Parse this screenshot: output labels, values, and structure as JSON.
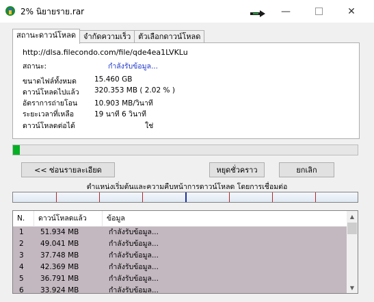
{
  "window": {
    "title": "2% นิยายราย.rar",
    "icon": "idm-app-icon",
    "controls": [
      "minimize-icon",
      "maximize-icon",
      "close-icon"
    ]
  },
  "tabs": [
    {
      "label": "สถานะดาวน์โหลด",
      "active": true
    },
    {
      "label": "จำกัดความเร็ว",
      "active": false
    },
    {
      "label": "ตัวเลือกดาวน์โหลด",
      "active": false
    }
  ],
  "info": {
    "url": "http://dlsa.filecondo.com/file/qde4ea1LVKLu",
    "status_label": "สถานะ:",
    "status_value": "กำลังรับข้อมูล...",
    "rows": [
      {
        "label": "ขนาดไฟล์ทั้งหมด",
        "value": "15.460  GB"
      },
      {
        "label": "ดาวน์โหลดไปแล้ว",
        "value": "320.353  MB  ( 2.02 % )"
      },
      {
        "label": "อัตราการถ่ายโอน",
        "value": "10.903  MB/วินาที"
      },
      {
        "label": "ระยะเวลาที่เหลือ",
        "value": "19  นาที 6  วินาที"
      },
      {
        "label": "ดาวน์โหลดต่อได้",
        "value": "ใช่"
      }
    ]
  },
  "progress": {
    "fraction": 0.0202,
    "color": "#06b025"
  },
  "buttons": {
    "hide_details": "<< ซ่อนรายละเอียด",
    "pause": "หยุดชั่วคราว",
    "cancel": "ยกเลิก"
  },
  "segments": {
    "caption": "ตำแหน่งเริ่มต้นและความคืบหน้าการดาวน์โหลด โดยการเชื่อมต่อ"
  },
  "connections": {
    "headers": [
      "N.",
      "ดาวน์โหลดแล้ว",
      "ข้อมูล"
    ],
    "rows": [
      {
        "n": "1",
        "downloaded": "51.934  MB",
        "info": "กำลังรับข้อมูล..."
      },
      {
        "n": "2",
        "downloaded": "49.041  MB",
        "info": "กำลังรับข้อมูล..."
      },
      {
        "n": "3",
        "downloaded": "37.748  MB",
        "info": "กำลังรับข้อมูล..."
      },
      {
        "n": "4",
        "downloaded": "42.369  MB",
        "info": "กำลังรับข้อมูล..."
      },
      {
        "n": "5",
        "downloaded": "36.791  MB",
        "info": "กำลังรับข้อมูล..."
      },
      {
        "n": "6",
        "downloaded": "33.924  MB",
        "info": "กำลังรับข้อมูล..."
      }
    ]
  }
}
